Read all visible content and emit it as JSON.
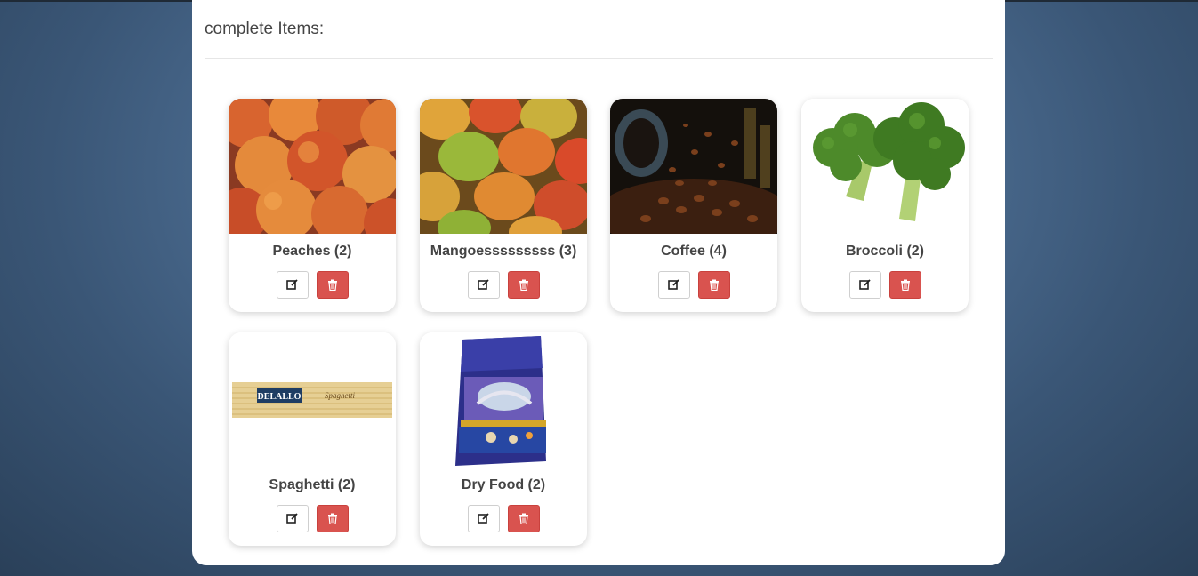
{
  "panel": {
    "header": "complete Items:"
  },
  "items": [
    {
      "label": "Peaches (2)",
      "image": "peaches-photo"
    },
    {
      "label": "Mangoesssssssss (3)",
      "image": "mangoes-photo"
    },
    {
      "label": "Coffee (4)",
      "image": "coffee-beans-photo"
    },
    {
      "label": "Broccoli (2)",
      "image": "broccoli-photo"
    },
    {
      "label": "Spaghetti (2)",
      "image": "spaghetti-package-photo"
    },
    {
      "label": "Dry Food (2)",
      "image": "dry-food-bag-photo"
    }
  ],
  "icons": {
    "edit": "edit-icon",
    "delete": "trash-icon"
  },
  "colors": {
    "delete_button": "#d9534f",
    "edit_button_border": "#cfcfcf",
    "panel_bg": "#ffffff"
  },
  "images": {
    "spaghetti_brand": "DELALLO",
    "spaghetti_name": "Spaghetti"
  }
}
